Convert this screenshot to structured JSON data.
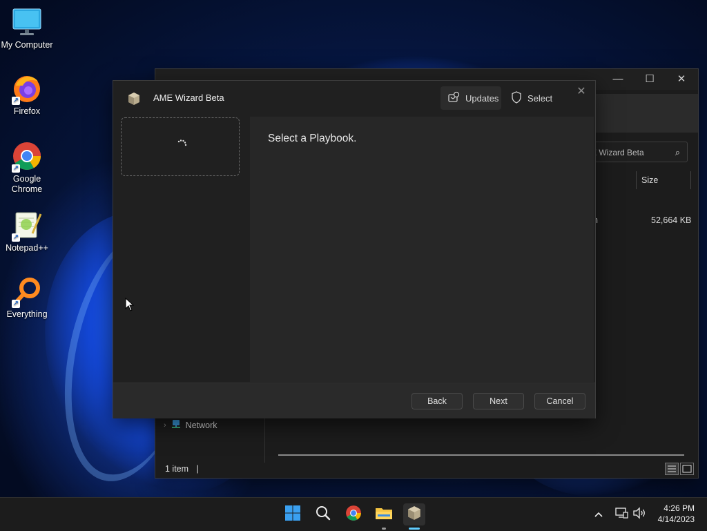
{
  "desktop": {
    "icons": [
      {
        "label": "My Computer",
        "icon": "monitor-icon"
      },
      {
        "label": "Firefox",
        "icon": "firefox-icon"
      },
      {
        "label": "Google Chrome",
        "icon": "chrome-icon"
      },
      {
        "label": "Notepad++",
        "icon": "notepadpp-icon"
      },
      {
        "label": "Everything",
        "icon": "everything-icon"
      }
    ]
  },
  "explorer": {
    "search_placeholder": "E Wizard Beta",
    "column_size": "Size",
    "file_name_fragment": "n",
    "file_size": "52,664 KB",
    "nav_network": "Network",
    "status_items": "1 item",
    "status_sep": "|"
  },
  "dialog": {
    "title": "AME Wizard Beta",
    "updates_label": "Updates",
    "select_label": "Select",
    "heading": "Select a Playbook.",
    "back_label": "Back",
    "next_label": "Next",
    "cancel_label": "Cancel"
  },
  "taskbar": {
    "apps": [
      "start-icon",
      "search-icon",
      "chrome-icon",
      "file-explorer-icon",
      "ame-wizard-icon"
    ],
    "time": "4:26 PM",
    "date": "4/14/2023",
    "accent": "#60cdff"
  }
}
